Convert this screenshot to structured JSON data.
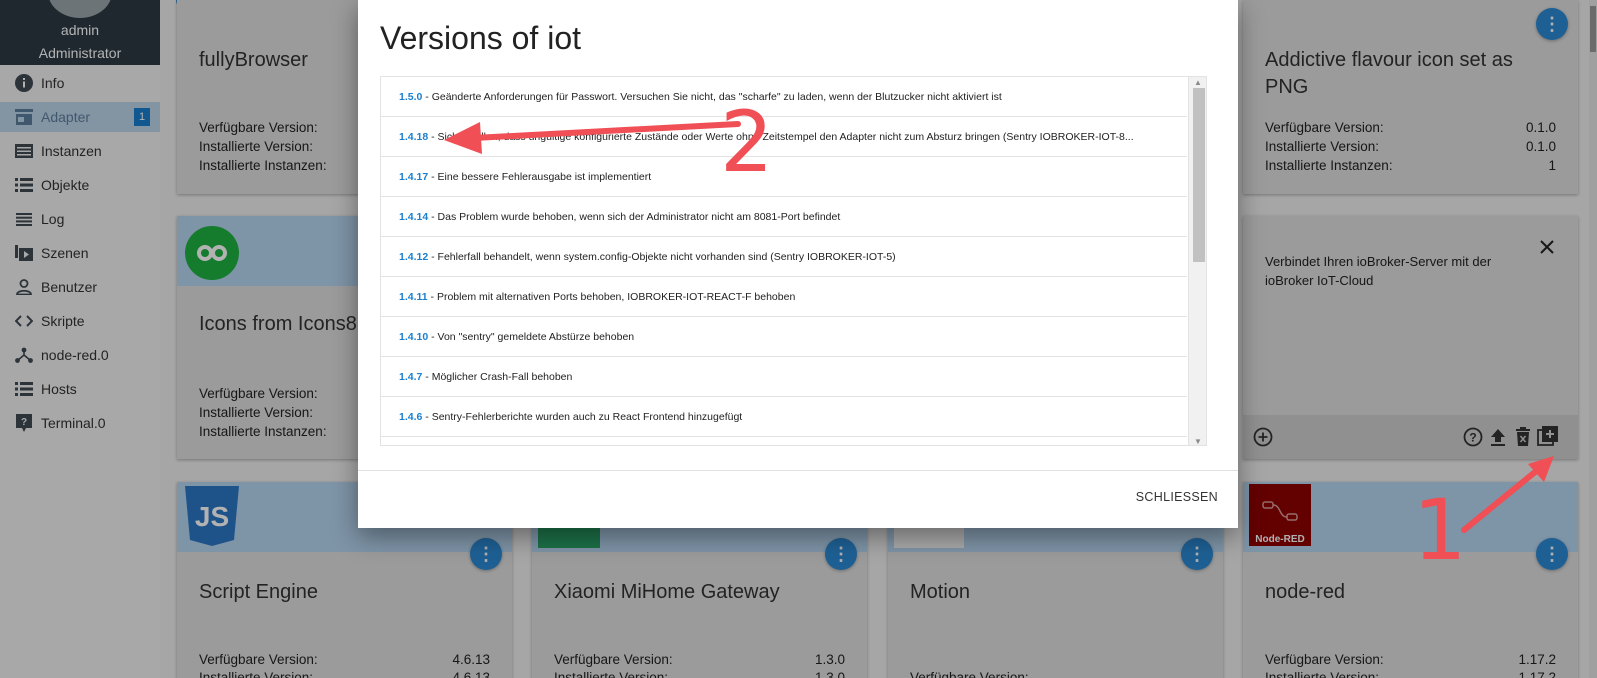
{
  "user": {
    "name": "admin",
    "role": "Administrator"
  },
  "nav": [
    {
      "label": "Info",
      "icon": "info-icon"
    },
    {
      "label": "Adapter",
      "icon": "store-icon",
      "badge": "1"
    },
    {
      "label": "Instanzen",
      "icon": "instances-icon"
    },
    {
      "label": "Objekte",
      "icon": "list-icon"
    },
    {
      "label": "Log",
      "icon": "log-icon"
    },
    {
      "label": "Szenen",
      "icon": "scenes-icon"
    },
    {
      "label": "Benutzer",
      "icon": "user-icon"
    },
    {
      "label": "Skripte",
      "icon": "code-icon"
    },
    {
      "label": "node-red.0",
      "icon": "node-red-icon"
    },
    {
      "label": "Hosts",
      "icon": "hosts-icon"
    },
    {
      "label": "Terminal.0",
      "icon": "terminal-icon"
    }
  ],
  "labels": {
    "available": "Verfügbare Version:",
    "installed": "Installierte Version:",
    "instances": "Installierte Instanzen:"
  },
  "cards": {
    "fully": {
      "title": "fullyBrowser"
    },
    "icons8": {
      "title": "Icons from Icons8"
    },
    "addictive": {
      "title": "Addictive flavour icon set as PNG",
      "available": "0.1.0",
      "installed": "0.1.0",
      "instances": "1"
    },
    "iot": {
      "description": "Verbindet Ihren ioBroker-Server mit der ioBroker IoT-Cloud"
    },
    "script": {
      "title": "Script Engine",
      "logo": "JS",
      "available": "4.6.13",
      "installed": "4.6.13"
    },
    "xiaomi": {
      "title": "Xiaomi MiHome Gateway",
      "available": "1.3.0",
      "installed": "1.3.0"
    },
    "motion": {
      "title": "Motion",
      "available": ""
    },
    "nodered": {
      "title": "node-red",
      "logo": "Node-RED",
      "available": "1.17.2",
      "installed": "1.17.2"
    }
  },
  "modal": {
    "title": "Versions of iot",
    "close_label": "SCHLIESSEN",
    "versions": [
      {
        "version": "1.5.0",
        "text": "Geänderte Anforderungen für Passwort. Versuchen Sie nicht, das \"scharfe\" zu laden, wenn der Blutzucker nicht aktiviert ist"
      },
      {
        "version": "1.4.18",
        "text": "Sicherstellen, dass ungültige konfigurierte Zustände oder Werte ohne Zeitstempel den Adapter nicht zum Absturz bringen (Sentry IOBROKER-IOT-8..."
      },
      {
        "version": "1.4.17",
        "text": "Eine bessere Fehlerausgabe ist implementiert"
      },
      {
        "version": "1.4.14",
        "text": "Das Problem wurde behoben, wenn sich der Administrator nicht am 8081-Port befindet"
      },
      {
        "version": "1.4.12",
        "text": "Fehlerfall behandelt, wenn system.config-Objekte nicht vorhanden sind (Sentry IOBROKER-IOT-5)"
      },
      {
        "version": "1.4.11",
        "text": "Problem mit alternativen Ports behoben, IOBROKER-IOT-REACT-F behoben"
      },
      {
        "version": "1.4.10",
        "text": "Von \"sentry\" gemeldete Abstürze behoben"
      },
      {
        "version": "1.4.7",
        "text": "Möglicher Crash-Fall behoben"
      },
      {
        "version": "1.4.6",
        "text": "Sentry-Fehlerberichte wurden auch zu React Frontend hinzugefügt"
      }
    ]
  },
  "annotations": {
    "first": "1",
    "second": "2",
    "color": "#ef4f55"
  }
}
